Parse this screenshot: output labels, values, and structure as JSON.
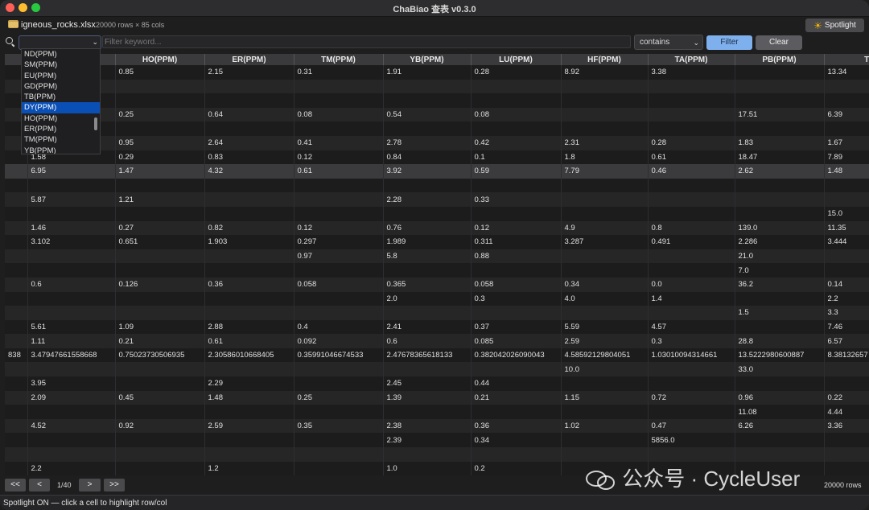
{
  "window": {
    "title": "ChaBiao 查表 v0.3.0"
  },
  "file": {
    "name": "igneous_rocks.xlsx",
    "info": "20000 rows × 85 cols"
  },
  "spotlight": {
    "label": "Spotlight",
    "icon": "sun-icon"
  },
  "filter": {
    "column_value": "",
    "keyword_placeholder": "Filter keyword...",
    "mode": "contains",
    "filter_label": "Filter",
    "clear_label": "Clear"
  },
  "dropdown": {
    "items": [
      "ND(PPM)",
      "SM(PPM)",
      "EU(PPM)",
      "GD(PPM)",
      "TB(PPM)",
      "DY(PPM)",
      "HO(PPM)",
      "ER(PPM)",
      "TM(PPM)",
      "YB(PPM)"
    ],
    "selected": "DY(PPM)"
  },
  "table": {
    "columns": [
      "",
      "",
      "HO(PPM)",
      "ER(PPM)",
      "TM(PPM)",
      "YB(PPM)",
      "LU(PPM)",
      "HF(PPM)",
      "TA(PPM)",
      "PB(PPM)",
      "TH(PPM)"
    ],
    "rows": [
      [
        "",
        "",
        "0.85",
        "2.15",
        "0.31",
        "1.91",
        "0.28",
        "8.92",
        "3.38",
        "",
        "13.34"
      ],
      [
        "",
        "",
        "",
        "",
        "",
        "",
        "",
        "",
        "",
        "",
        ""
      ],
      [
        "",
        "",
        "",
        "",
        "",
        "",
        "",
        "",
        "",
        "",
        ""
      ],
      [
        "",
        "",
        "0.25",
        "0.64",
        "0.08",
        "0.54",
        "0.08",
        "",
        "",
        "17.51",
        "6.39"
      ],
      [
        "",
        "",
        "",
        "",
        "",
        "",
        "",
        "",
        "",
        "",
        ""
      ],
      [
        "",
        "",
        "0.95",
        "2.64",
        "0.41",
        "2.78",
        "0.42",
        "2.31",
        "0.28",
        "1.83",
        "1.67"
      ],
      [
        "",
        "1.58",
        "0.29",
        "0.83",
        "0.12",
        "0.84",
        "0.1",
        "1.8",
        "0.61",
        "18.47",
        "7.89"
      ],
      [
        "",
        "6.95",
        "1.47",
        "4.32",
        "0.61",
        "3.92",
        "0.59",
        "7.79",
        "0.46",
        "2.62",
        "1.48"
      ],
      [
        "",
        "",
        "",
        "",
        "",
        "",
        "",
        "",
        "",
        "",
        ""
      ],
      [
        "",
        "5.87",
        "1.21",
        "",
        "",
        "2.28",
        "0.33",
        "",
        "",
        "",
        ""
      ],
      [
        "",
        "",
        "",
        "",
        "",
        "",
        "",
        "",
        "",
        "",
        "15.0"
      ],
      [
        "",
        "1.46",
        "0.27",
        "0.82",
        "0.12",
        "0.76",
        "0.12",
        "4.9",
        "0.8",
        "139.0",
        "11.35"
      ],
      [
        "",
        "3.102",
        "0.651",
        "1.903",
        "0.297",
        "1.989",
        "0.311",
        "3.287",
        "0.491",
        "2.286",
        "3.444"
      ],
      [
        "",
        "",
        "",
        "",
        "0.97",
        "5.8",
        "0.88",
        "",
        "",
        "21.0",
        ""
      ],
      [
        "",
        "",
        "",
        "",
        "",
        "",
        "",
        "",
        "",
        "7.0",
        ""
      ],
      [
        "",
        "0.6",
        "0.126",
        "0.36",
        "0.058",
        "0.365",
        "0.058",
        "0.34",
        "0.0",
        "36.2",
        "0.14"
      ],
      [
        "",
        "",
        "",
        "",
        "",
        "2.0",
        "0.3",
        "4.0",
        "1.4",
        "",
        "2.2"
      ],
      [
        "",
        "",
        "",
        "",
        "",
        "",
        "",
        "",
        "",
        "1.5",
        "3.3"
      ],
      [
        "",
        "5.61",
        "1.09",
        "2.88",
        "0.4",
        "2.41",
        "0.37",
        "5.59",
        "4.57",
        "",
        "7.46"
      ],
      [
        "",
        "1.11",
        "0.21",
        "0.61",
        "0.092",
        "0.6",
        "0.085",
        "2.59",
        "0.3",
        "28.8",
        "6.57"
      ],
      [
        "838",
        "3.47947661558668",
        "0.75023730506935",
        "2.30586010668405",
        "0.35991046674533",
        "2.47678365618133",
        "0.382042026090043",
        "4.58592129804051",
        "1.03010094314661",
        "13.5222980600887",
        "8.38132657"
      ],
      [
        "",
        "",
        "",
        "",
        "",
        "",
        "",
        "10.0",
        "",
        "33.0",
        ""
      ],
      [
        "",
        "3.95",
        "",
        "2.29",
        "",
        "2.45",
        "0.44",
        "",
        "",
        "",
        ""
      ],
      [
        "",
        "2.09",
        "0.45",
        "1.48",
        "0.25",
        "1.39",
        "0.21",
        "1.15",
        "0.72",
        "0.96",
        "0.22"
      ],
      [
        "",
        "",
        "",
        "",
        "",
        "",
        "",
        "",
        "",
        "11.08",
        "4.44"
      ],
      [
        "",
        "4.52",
        "0.92",
        "2.59",
        "0.35",
        "2.38",
        "0.36",
        "1.02",
        "0.47",
        "6.26",
        "3.36"
      ],
      [
        "",
        "",
        "",
        "",
        "",
        "2.39",
        "0.34",
        "",
        "5856.0",
        "",
        ""
      ],
      [
        "",
        "",
        "",
        "",
        "",
        "",
        "",
        "",
        "",
        "",
        ""
      ],
      [
        "",
        "2.2",
        "",
        "1.2",
        "",
        "1.0",
        "0.2",
        "",
        "",
        "",
        ""
      ]
    ],
    "highlighted_row": 7
  },
  "pager": {
    "first": "<<",
    "prev": "<",
    "page": "1/40",
    "next": ">",
    "last": ">>",
    "rows": "20000 rows"
  },
  "watermark": {
    "text": "公众号 · CycleUser"
  },
  "status": {
    "text": "Spotlight ON — click a cell to highlight row/col"
  }
}
